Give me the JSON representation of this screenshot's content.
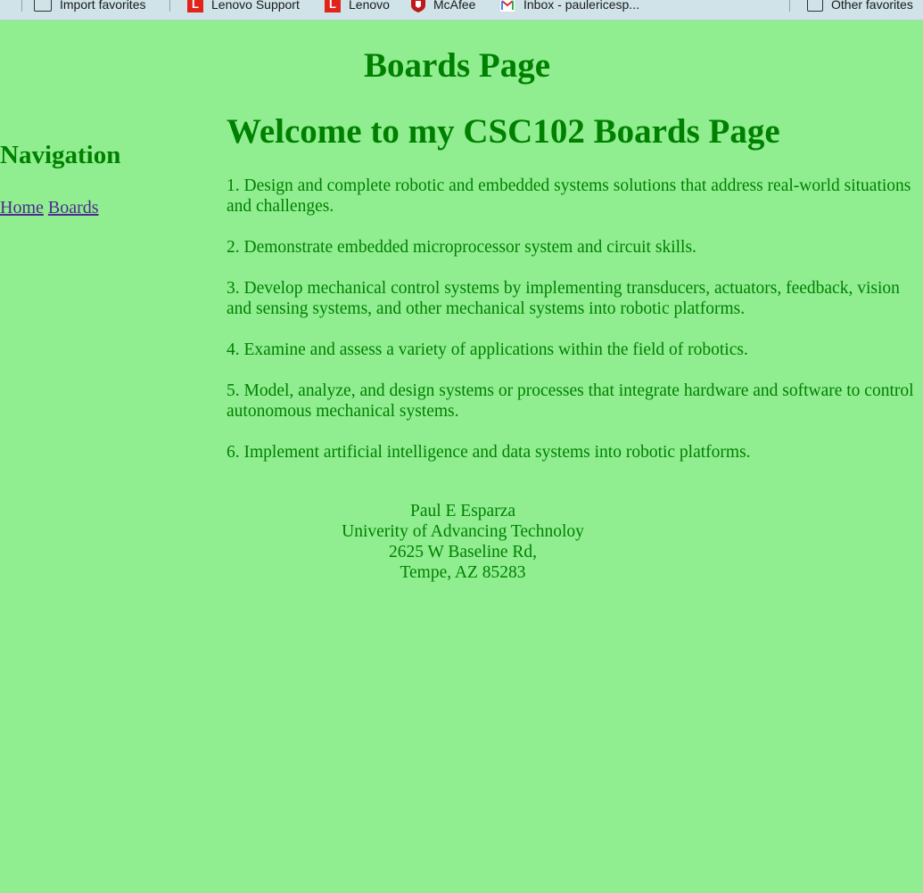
{
  "favorites_bar": {
    "items": [
      {
        "label": "Import favorites",
        "icon": "import-icon"
      },
      {
        "label": "Lenovo Support",
        "icon": "lenovo-icon"
      },
      {
        "label": "Lenovo",
        "icon": "lenovo-icon"
      },
      {
        "label": "McAfee",
        "icon": "mcafee-shield-icon"
      },
      {
        "label": "Inbox - paulericesp...",
        "icon": "gmail-icon"
      },
      {
        "label": "Other favorites",
        "icon": "folder-icon"
      }
    ]
  },
  "page": {
    "header": "Boards Page",
    "welcome": "Welcome to my CSC102 Boards Page"
  },
  "navigation": {
    "heading": "Navigation",
    "links": [
      {
        "label": "Home"
      },
      {
        "label": "Boards"
      }
    ]
  },
  "objectives": [
    "1. Design and complete robotic and embedded systems solutions that address real-world situations and challenges.",
    "2. Demonstrate embedded microprocessor system and circuit skills.",
    "3. Develop mechanical control systems by implementing transducers, actuators, feedback, vision and sensing systems, and other mechanical systems into robotic platforms.",
    "4. Examine and assess a variety of applications within the field of robotics.",
    "5. Model, analyze, and design systems or processes that integrate hardware and software to control autonomous mechanical systems.",
    "6. Implement artificial intelligence and data systems into robotic platforms."
  ],
  "footer": {
    "name": "Paul E Esparza",
    "school": "Univerity of Advancing Technoloy",
    "street": "2625 W Baseline Rd,",
    "city": "Tempe, AZ 85283"
  },
  "colors": {
    "page_background": "#90EE90",
    "text_green": "#008000",
    "link": "#4b2b8f"
  }
}
